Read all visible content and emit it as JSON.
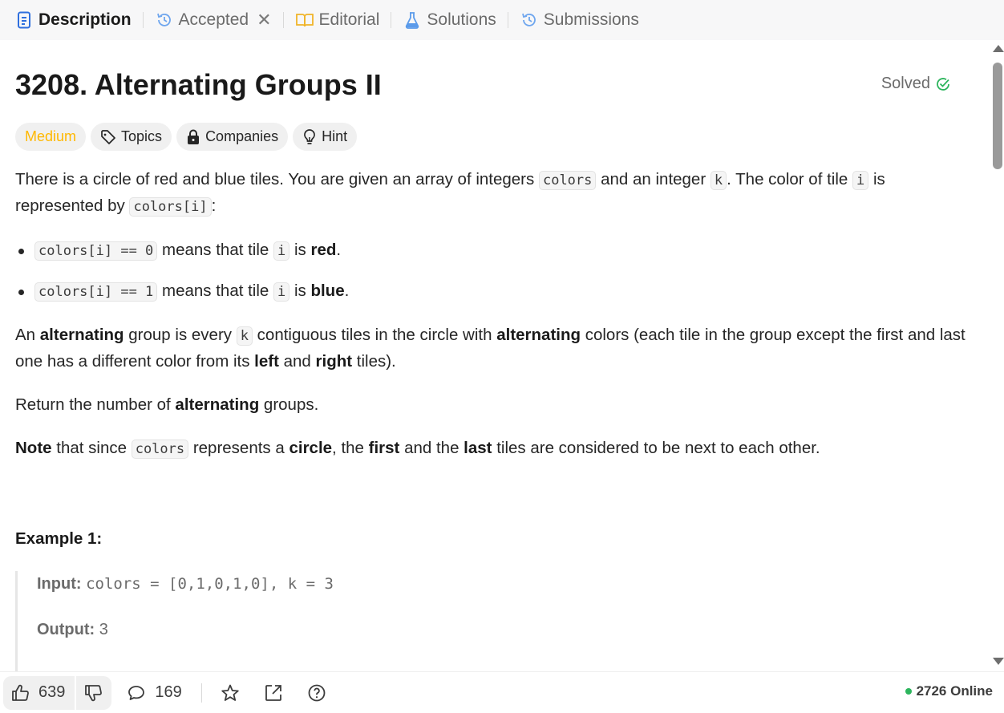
{
  "tabs": [
    {
      "label": "Description",
      "icon": "description-icon",
      "active": true
    },
    {
      "label": "Accepted",
      "icon": "history-icon",
      "active": false
    },
    {
      "label": "Editorial",
      "icon": "book-icon",
      "active": false
    },
    {
      "label": "Solutions",
      "icon": "flask-icon",
      "active": false
    },
    {
      "label": "Submissions",
      "icon": "history-icon",
      "active": false
    }
  ],
  "problem": {
    "title": "3208. Alternating Groups II",
    "status": "Solved",
    "difficulty": "Medium",
    "tags": [
      "Topics",
      "Companies",
      "Hint"
    ]
  },
  "description": {
    "p1_a": "There is a circle of red and blue tiles. You are given an array of integers ",
    "p1_code1": "colors",
    "p1_b": " and an integer ",
    "p1_code2": "k",
    "p1_c": ". The color of tile ",
    "p1_code3": "i",
    "p1_d": " is represented by ",
    "p1_code4": "colors[i]",
    "p1_e": ":",
    "b1_code": "colors[i] == 0",
    "b1_a": " means that tile ",
    "b1_code2": "i",
    "b1_b": " is ",
    "b1_bold": "red",
    "b1_c": ".",
    "b2_code": "colors[i] == 1",
    "b2_a": " means that tile ",
    "b2_code2": "i",
    "b2_b": " is ",
    "b2_bold": "blue",
    "b2_c": ".",
    "p2_a": "An ",
    "p2_b1": "alternating",
    "p2_b": " group is every ",
    "p2_code": "k",
    "p2_c": " contiguous tiles in the circle with ",
    "p2_b2": "alternating",
    "p2_d": " colors (each tile in the group except the first and last one has a different color from its ",
    "p2_b3": "left",
    "p2_e": " and ",
    "p2_b4": "right",
    "p2_f": " tiles).",
    "p3_a": "Return the number of ",
    "p3_b": "alternating",
    "p3_c": " groups.",
    "p4_b1": "Note",
    "p4_a": " that since ",
    "p4_code": "colors",
    "p4_b": " represents a ",
    "p4_b2": "circle",
    "p4_c": ", the ",
    "p4_b3": "first",
    "p4_d": " and the ",
    "p4_b4": "last",
    "p4_e": " tiles are considered to be next to each other."
  },
  "example": {
    "title": "Example 1:",
    "input_label": "Input:",
    "input_value": "colors = [0,1,0,1,0], k = 3",
    "output_label": "Output:",
    "output_value": "3"
  },
  "footer": {
    "likes": "639",
    "comments": "169",
    "online": "2726 Online"
  },
  "colors": {
    "medium": "#ffb800",
    "solved": "#2db55d",
    "active_tab_icon": "#2f6fde"
  }
}
